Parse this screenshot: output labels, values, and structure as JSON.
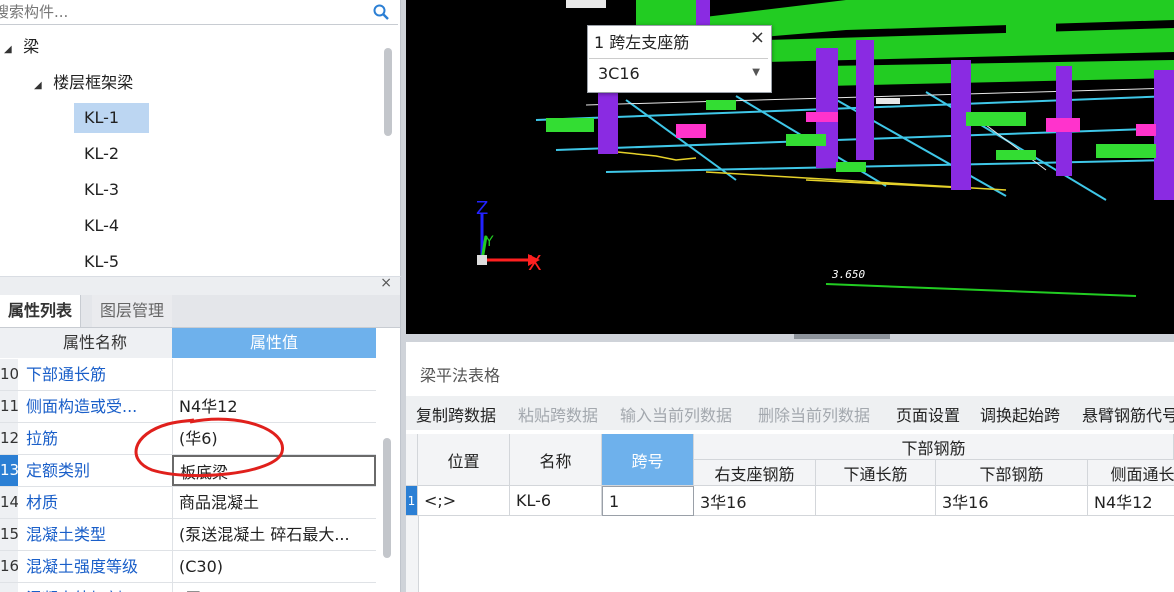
{
  "component_tree": {
    "search_placeholder": "搜索构件...",
    "items": [
      {
        "label": "梁",
        "level": 0,
        "expanded": true
      },
      {
        "label": "楼层框架梁",
        "level": 1,
        "expanded": true
      },
      {
        "label": "KL-1",
        "level": 2,
        "selected": true
      },
      {
        "label": "KL-2",
        "level": 2
      },
      {
        "label": "KL-3",
        "level": 2
      },
      {
        "label": "KL-4",
        "level": 2
      },
      {
        "label": "KL-5",
        "level": 2
      }
    ]
  },
  "property_panel": {
    "tabs": [
      "属性列表",
      "图层管理"
    ],
    "active_tab": "属性列表",
    "columns": [
      "属性名称",
      "属性值"
    ],
    "rows": [
      {
        "num": "10",
        "name": "下部通长筋",
        "value": ""
      },
      {
        "num": "11",
        "name": "侧面构造或受...",
        "value": "N4华12"
      },
      {
        "num": "12",
        "name": "拉筋",
        "value": "(华6)"
      },
      {
        "num": "13",
        "name": "定额类别",
        "value": "板底梁",
        "selected": true,
        "editing": true
      },
      {
        "num": "14",
        "name": "材质",
        "value": "商品混凝土"
      },
      {
        "num": "15",
        "name": "混凝土类型",
        "value": "(泵送混凝土 碎石最大..."
      },
      {
        "num": "16",
        "name": "混凝土强度等级",
        "value": "(C30)"
      },
      {
        "num": "17",
        "name": "混凝土外加剂",
        "value": "(无)"
      }
    ]
  },
  "viewport": {
    "elevation_label": "3.650",
    "axes": {
      "z": "Z",
      "y": "Y",
      "x": "X"
    },
    "popup": {
      "title": "1 跨左支座筋",
      "close": "×",
      "value": "3C16"
    }
  },
  "beam_table": {
    "title": "梁平法表格",
    "toolbar": [
      {
        "label": "复制跨数据",
        "enabled": true
      },
      {
        "label": "粘贴跨数据",
        "enabled": false
      },
      {
        "label": "输入当前列数据",
        "enabled": false
      },
      {
        "label": "删除当前列数据",
        "enabled": false
      },
      {
        "label": "页面设置",
        "enabled": true
      },
      {
        "label": "调换起始跨",
        "enabled": true
      },
      {
        "label": "悬臂钢筋代号",
        "enabled": true
      }
    ],
    "headers": {
      "position": "位置",
      "name": "名称",
      "span": "跨号",
      "group_bottom": "下部钢筋",
      "right_support": "右支座钢筋",
      "bottom_through": "下通长筋",
      "bottom_bar": "下部钢筋",
      "side_through": "侧面通长"
    },
    "rows": [
      {
        "num": "1",
        "position": "<;>",
        "name": "KL-6",
        "span": "1",
        "right_support": "3华16",
        "bottom_through": "",
        "bottom_bar": "3华16",
        "side_through": "N4华12"
      }
    ]
  },
  "colors": {
    "accent": "#2b7fd4",
    "active_header": "#6eb1ec",
    "beam_green": "#22cc22",
    "column_purple": "#8a2be2",
    "annotation_red": "#e0201c"
  }
}
